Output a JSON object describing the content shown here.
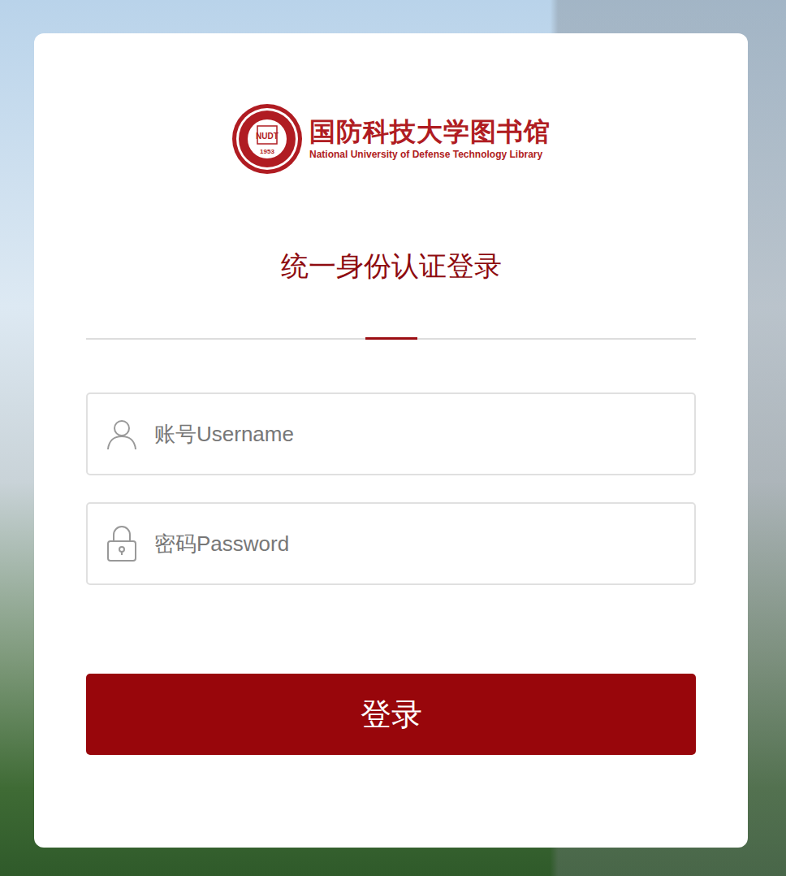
{
  "library": {
    "name_cn": "国防科技大学图书馆",
    "name_en": "National University of Defense Technology Library",
    "seal_mark": "NUDT",
    "seal_year": "1953"
  },
  "title": "统一身份认证登录",
  "fields": [
    {
      "kind": "user",
      "placeholder": "账号Username"
    },
    {
      "kind": "password",
      "placeholder": "密码Password"
    }
  ],
  "submit": "登录"
}
